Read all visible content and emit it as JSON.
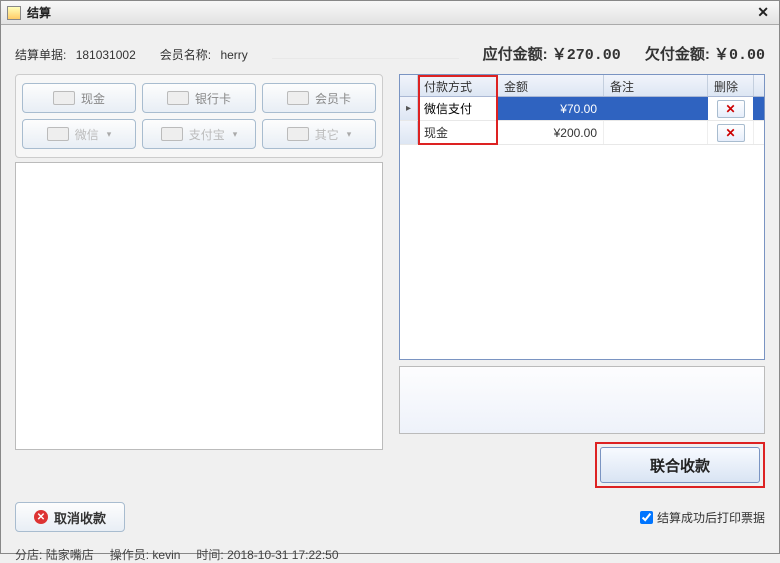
{
  "window": {
    "title": "结算"
  },
  "header": {
    "order_label": "结算单据:",
    "order_value": "181031002",
    "member_label": "会员名称:",
    "member_value": "herry",
    "due_label": "应付金额:",
    "due_value": "￥270.00",
    "owe_label": "欠付金额:",
    "owe_value": "￥0.00"
  },
  "paymethods": {
    "cash": "现金",
    "bank": "银行卡",
    "member": "会员卡",
    "wechat": "微信",
    "alipay": "支付宝",
    "other": "其它"
  },
  "grid": {
    "headers": {
      "method": "付款方式",
      "amount": "金额",
      "note": "备注",
      "delete": "删除"
    },
    "rows": [
      {
        "method": "微信支付",
        "amount": "¥70.00",
        "note": ""
      },
      {
        "method": "现金",
        "amount": "¥200.00",
        "note": ""
      }
    ]
  },
  "buttons": {
    "combine": "联合收款",
    "cancel": "取消收款"
  },
  "checkbox": {
    "label": "结算成功后打印票据"
  },
  "status": {
    "store_label": "分店:",
    "store_value": "陆家嘴店",
    "operator_label": "操作员:",
    "operator_value": "kevin",
    "time_label": "时间:",
    "time_value": "2018-10-31 17:22:50"
  }
}
